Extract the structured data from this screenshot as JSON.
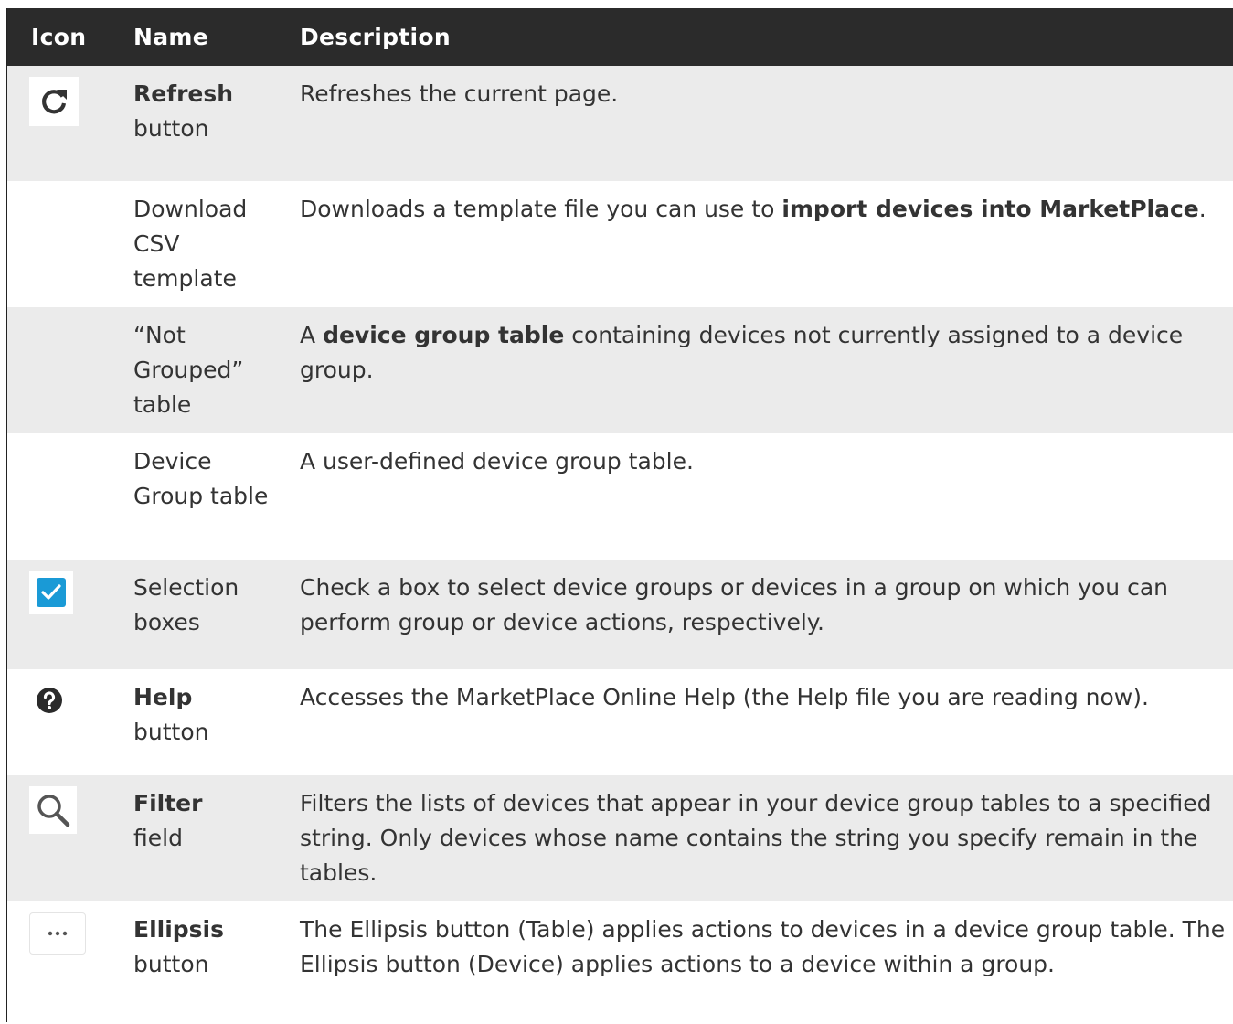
{
  "headers": {
    "icon": "Icon",
    "name": "Name",
    "description": "Description"
  },
  "rows": [
    {
      "icon": "refresh-icon",
      "name_bold": "Refresh",
      "name_rest": "button",
      "desc": [
        {
          "t": "Refreshes the current page."
        }
      ]
    },
    {
      "icon": "",
      "name_bold": "",
      "name_rest": "Download CSV template",
      "desc": [
        {
          "t": "Downloads a template file you can use to "
        },
        {
          "b": "import devices into MarketPlace"
        },
        {
          "t": "."
        }
      ]
    },
    {
      "icon": "",
      "name_bold": "",
      "name_rest": "“Not Grouped” table",
      "desc": [
        {
          "t": "A "
        },
        {
          "b": "device group table"
        },
        {
          "t": " containing devices not currently assigned to a device group."
        }
      ]
    },
    {
      "icon": "",
      "name_bold": "",
      "name_rest": "Device Group table",
      "desc": [
        {
          "t": "A user-defined device group table."
        }
      ]
    },
    {
      "icon": "checkbox-icon",
      "name_bold": "",
      "name_rest": "Selection boxes",
      "desc": [
        {
          "t": "Check a box to select device groups or devices in a group on which you can perform group or device actions, respectively."
        }
      ]
    },
    {
      "icon": "help-icon",
      "name_bold": "Help",
      "name_rest": "button",
      "desc": [
        {
          "t": "Accesses the MarketPlace Online Help (the Help file you are reading now)."
        }
      ]
    },
    {
      "icon": "search-icon",
      "name_bold": "Filter",
      "name_rest": "field",
      "desc": [
        {
          "t": "Filters the lists of devices that appear in your device group tables to a specified string. Only devices whose name contains the string you specify remain in the tables."
        }
      ]
    },
    {
      "icon": "ellipsis-icon",
      "name_bold": "Ellipsis",
      "name_rest": "button",
      "desc": [
        {
          "t": "The Ellipsis button (Table) applies actions to devices in a device group table. The Ellipsis button (Device) applies actions to a device within a group."
        }
      ]
    }
  ],
  "colors": {
    "header_bg": "#2b2b2b",
    "row_shade": "#ebebeb",
    "checkbox_blue": "#1a9ad6"
  }
}
